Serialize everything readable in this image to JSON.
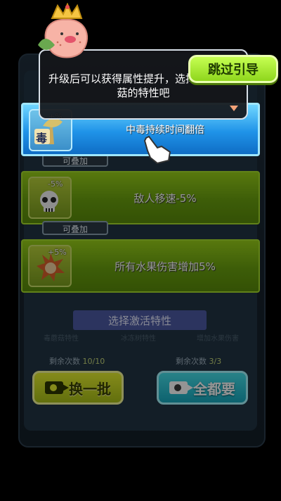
{
  "hint": {
    "text": "升级后可以获得属性提升，选择这个毒蘑菇的特性吧"
  },
  "skip_label": "跳过引导",
  "cards": [
    {
      "icon": "poison-badge-icon",
      "pct": "+%",
      "glyph": "毒",
      "desc": "中毒持续时间翻倍",
      "selected": true
    },
    {
      "icon": "skull-icon",
      "pct": "-5%",
      "desc": "敌人移速-5%",
      "tag": "可叠加"
    },
    {
      "icon": "fruit-burst-icon",
      "pct": "+5%",
      "desc": "所有水果伤害增加5%",
      "tag": "可叠加"
    }
  ],
  "choose_label": "选择激活特性",
  "left": {
    "remain_label": "剩余次数",
    "remain_value": "10/10",
    "button": "换一批"
  },
  "right": {
    "remain_label": "剩余次数",
    "remain_value": "3/3",
    "button": "全都要"
  },
  "ghost_texts": [
    "毒蘑菇特性",
    "冰冻树特性",
    "增加水果伤害"
  ],
  "colors": {
    "selected_card": "#1f93e8",
    "green_card": "#6aa10f",
    "skip_button": "#8fd61d"
  }
}
